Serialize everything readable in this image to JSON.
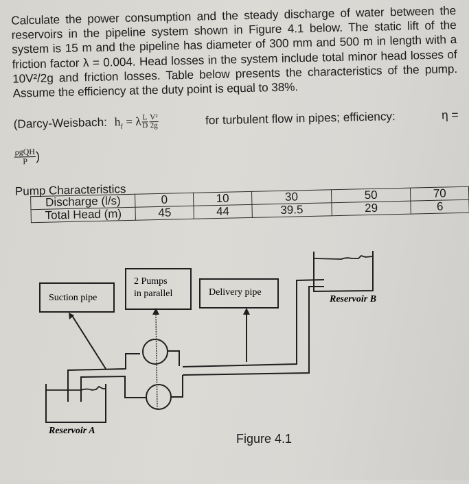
{
  "problem": {
    "lines": [
      "Calculate the power consumption and the steady discharge of water",
      "between the reservoirs in the pipeline system shown in Figure 4.1 below.",
      "The static lift of the system is 15 m and the pipeline has diameter of 300",
      "mm and 500 m in length with a friction factor λ = 0.004. Head losses in the",
      "system include total minor head losses of 10V²/2g and friction losses.",
      "Table below presents the characteristics of the pump. Assume the",
      "efficiency at the duty point is equal to 38%."
    ],
    "formula": {
      "prefix": "(Darcy-Weisbach:",
      "lhs": "h",
      "lhs_sub": "f",
      "equals": "= λ",
      "frac1_num": "L",
      "frac1_den": "D",
      "frac2_num": "V²",
      "frac2_den": "2g",
      "suffix": "for turbulent flow in pipes; efficiency:",
      "eta": "η =",
      "eta_num": "ρgQH",
      "eta_den": "P",
      "close": ")"
    }
  },
  "table": {
    "caption": "Pump Characteristics",
    "rows": [
      {
        "label": "Discharge (l/s)",
        "values": [
          "0",
          "10",
          "30",
          "50",
          "70"
        ]
      },
      {
        "label": "Total Head (m)",
        "values": [
          "45",
          "44",
          "39.5",
          "29",
          "6"
        ]
      }
    ]
  },
  "figure": {
    "caption": "Figure 4.1",
    "labels": {
      "suction": "Suction pipe",
      "pumps_line1": "2 Pumps",
      "pumps_line2": "in parallel",
      "delivery": "Delivery pipe",
      "reservoir_a": "Reservoir A",
      "reservoir_b": "Reservoir B"
    }
  },
  "chart_data": {
    "type": "table",
    "title": "Pump Characteristics",
    "columns": [
      "Discharge (l/s)",
      "Total Head (m)"
    ],
    "x": [
      0,
      10,
      30,
      50,
      70
    ],
    "series": [
      {
        "name": "Total Head (m)",
        "values": [
          45,
          44,
          39.5,
          29,
          6
        ]
      }
    ],
    "xlabel": "Discharge (l/s)",
    "ylabel": "Total Head (m)"
  }
}
